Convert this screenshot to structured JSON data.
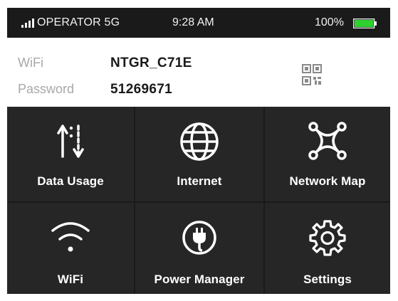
{
  "status_bar": {
    "operator": "OPERATOR 5G",
    "time": "9:28 AM",
    "battery_percent": "100%",
    "battery_level": 1.0,
    "signal_icon": "signal-bars-icon",
    "battery_icon": "battery-full-icon"
  },
  "wifi_info": {
    "ssid_label": "WiFi",
    "ssid_value": "NTGR_C71E",
    "password_label": "Password",
    "password_value": "51269671",
    "qr_icon": "qr-code-icon"
  },
  "tiles": [
    {
      "label": "Data Usage",
      "icon": "data-usage-icon"
    },
    {
      "label": "Internet",
      "icon": "globe-icon"
    },
    {
      "label": "Network Map",
      "icon": "network-map-icon"
    },
    {
      "label": "WiFi",
      "icon": "wifi-icon"
    },
    {
      "label": "Power Manager",
      "icon": "power-plug-icon"
    },
    {
      "label": "Settings",
      "icon": "gear-icon"
    }
  ],
  "colors": {
    "background": "#1a1a1a",
    "tile": "#262626",
    "text": "#ffffff",
    "battery_fill": "#2fd12f",
    "label_gray": "#a8a8a8"
  }
}
